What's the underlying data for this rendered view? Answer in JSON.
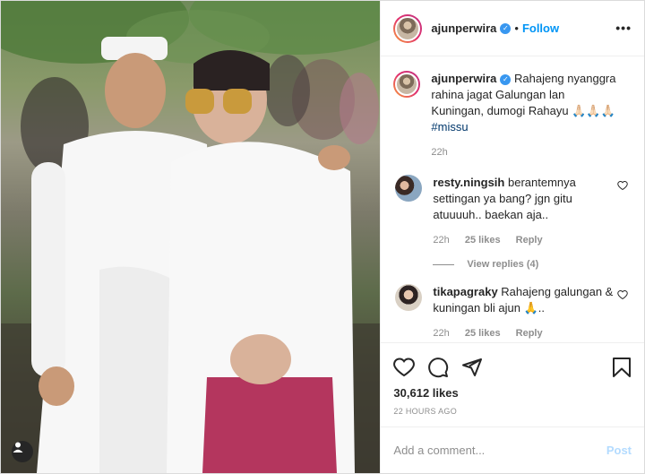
{
  "post": {
    "username": "ajunperwira",
    "follow_label": "Follow",
    "separator": "•",
    "caption_text": "Rahajeng nyanggra rahina jagat Galungan lan Kuningan, dumogi Rahayu 🙏🏻🙏🏻🙏🏻",
    "hashtag": "#missu",
    "caption_time": "22h",
    "likes": "30,612 likes",
    "timestamp": "22 HOURS AGO",
    "more_label": "•••"
  },
  "comments": [
    {
      "username": "resty.ningsih",
      "text": "berantemnya settingan ya bang? jgn gitu atuuuuh.. baekan aja..",
      "time": "22h",
      "likes": "25 likes",
      "reply_label": "Reply",
      "view_replies": "View replies (4)"
    },
    {
      "username": "tikapagraky",
      "text": "Rahajeng galungan & kuningan bli ajun 🙏..",
      "time": "22h",
      "likes": "25 likes",
      "reply_label": "Reply"
    }
  ],
  "add_comment": {
    "placeholder": "Add a comment...",
    "post_label": "Post"
  },
  "icons": {
    "like": "heart-icon",
    "comment": "comment-icon",
    "share": "share-icon",
    "save": "bookmark-icon",
    "tag": "user-tag-icon",
    "verified": "verified-badge-icon"
  },
  "colors": {
    "link_blue": "#0095f6",
    "verified_blue": "#3897f0",
    "hashtag": "#00376b",
    "muted": "#8e8e8e",
    "post_disabled": "#b3dbff"
  }
}
